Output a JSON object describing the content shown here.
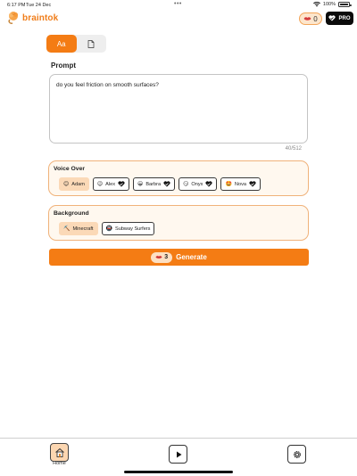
{
  "status_bar": {
    "time": "6:17 PM",
    "date": "Tue 24 Dec",
    "battery": "100%"
  },
  "app": {
    "name": "braintok",
    "accent": "#f47c14"
  },
  "header": {
    "credits": "0",
    "pro_label": "PRO"
  },
  "mode_toggle": {
    "text_label": "Aa",
    "active": "text"
  },
  "prompt": {
    "title": "Prompt",
    "value": "do you feel friction on smooth surfaces?",
    "counter": "40/512"
  },
  "voice_over": {
    "title": "Voice Over",
    "options": [
      {
        "label": "Adam",
        "emoji": "😊",
        "locked": false,
        "selected": true
      },
      {
        "label": "Alex",
        "emoji": "😉",
        "locked": true,
        "selected": false
      },
      {
        "label": "Barbra",
        "emoji": "😀",
        "locked": true,
        "selected": false
      },
      {
        "label": "Onyx",
        "emoji": "😏",
        "locked": true,
        "selected": false
      },
      {
        "label": "Nova",
        "emoji": "🤩",
        "locked": true,
        "selected": false
      }
    ]
  },
  "background": {
    "title": "Background",
    "options": [
      {
        "label": "Minecraft",
        "emoji": "⛏️",
        "selected": true
      },
      {
        "label": "Subway Surfers",
        "emoji": "🚇",
        "selected": false
      }
    ]
  },
  "generate": {
    "cost": "3",
    "label": "Generate"
  },
  "nav": {
    "home_label": "Home"
  }
}
